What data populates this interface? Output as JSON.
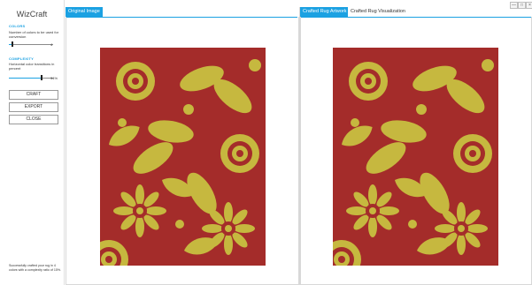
{
  "app": {
    "title": "WizCraft"
  },
  "window_controls": {
    "minimize": "—",
    "maximize": "□",
    "close": "×"
  },
  "sidebar": {
    "colors": {
      "heading": "COLORS",
      "description": "Number of colors to be used for conversion",
      "value": "4",
      "level": 0.15
    },
    "complexity": {
      "heading": "COMPLEXITY",
      "description": "Horizontal color transitions in percent",
      "value": "34%",
      "level": 0.34
    },
    "buttons": {
      "craft": "CRAFT",
      "export": "EXPORT",
      "close": "CLOSE"
    },
    "status": "Successfully crafted your rug in 4 colors with a complexity ratio of 15%."
  },
  "left_pane": {
    "tab": "Original Image",
    "image": "floral-rug-pattern"
  },
  "right_pane": {
    "tabs": [
      "Crafted Rug Artwork",
      "Crafted Rug Visualization"
    ],
    "image": "floral-rug-pattern-crafted"
  },
  "colors": {
    "accent": "#1ba1e2",
    "rug_background": "#a42c2a",
    "rug_pattern": "#c6b83f"
  }
}
